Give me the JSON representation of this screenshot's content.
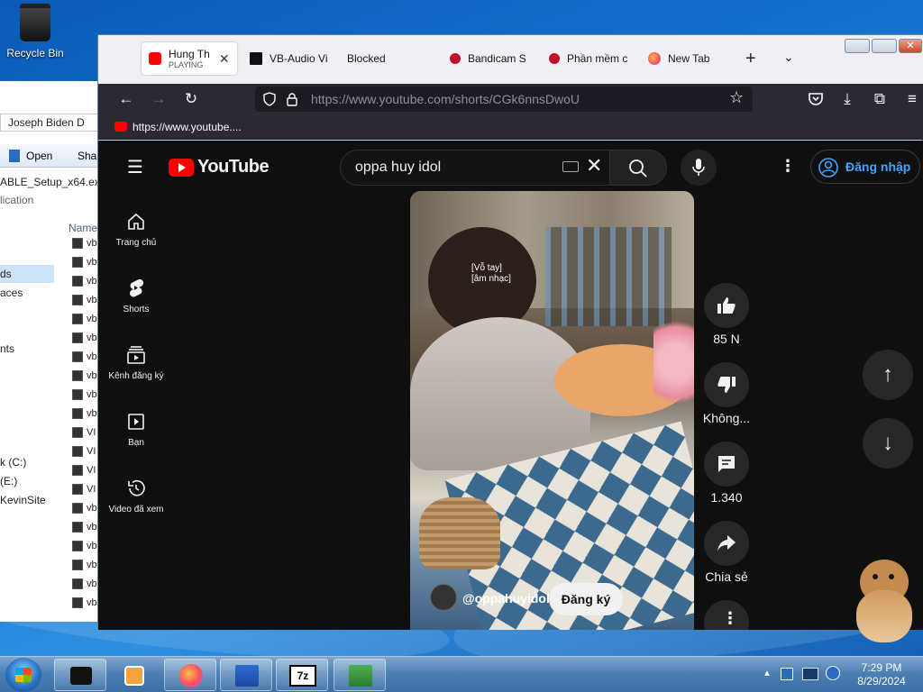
{
  "desktop": {
    "recycle_bin_label": "Recycle Bin"
  },
  "explorer": {
    "path_text": "Joseph Biden",
    "path_extra": "D",
    "open_label": "Open",
    "share_label": "Sha",
    "selected_file": "ABLE_Setup_x64.ex",
    "selected_type": "lication",
    "nav_items": [
      "ds",
      "aces",
      "nts",
      "k (C:)",
      "(E:)",
      "KevinSite"
    ],
    "column_header": "Name",
    "file_labels": [
      "vb",
      "vb",
      "vb",
      "vb",
      "vb",
      "vb",
      "vb",
      "vb",
      "vb",
      "vb",
      "VI",
      "VI",
      "VI",
      "VI",
      "vb",
      "vb",
      "vb",
      "vb",
      "vb",
      "vb"
    ]
  },
  "browser": {
    "tabs": [
      {
        "title": "Hung Th",
        "subtitle": "PLAYING",
        "icon": "youtube-icon",
        "active": true
      },
      {
        "title": "VB-Audio Vi",
        "icon": "vb-icon"
      },
      {
        "title": "Blocked",
        "icon": "none"
      },
      {
        "title": "Bandicam S",
        "icon": "bandicam-icon"
      },
      {
        "title": "Phần mềm c",
        "icon": "bandicam-icon"
      },
      {
        "title": "New Tab",
        "icon": "firefox-icon"
      }
    ],
    "url": "https://www.youtube.com/shorts/CGk6nnsDwoU",
    "bookmark_label": "https://www.youtube...."
  },
  "youtube": {
    "logo_text": "YouTube",
    "search_value": "oppa huy idol",
    "sign_in_label": "Đăng nhập",
    "sidebar": [
      {
        "label": "Trang chủ",
        "icon": "home-icon"
      },
      {
        "label": "Shorts",
        "icon": "shorts-icon"
      },
      {
        "label": "Kênh đăng ký",
        "icon": "subscriptions-icon"
      },
      {
        "label": "Bạn",
        "icon": "you-icon"
      },
      {
        "label": "Video đã xem",
        "icon": "history-icon"
      }
    ],
    "caption_line1": "[Vỗ tay]",
    "caption_line2": "[âm nhạc]",
    "channel_handle": "@oppahuyidol",
    "subscribe_label": "Đăng ký",
    "actions": {
      "like_count": "85 N",
      "dislike_label": "Không...",
      "comment_count": "1.340",
      "share_label": "Chia sẻ"
    }
  },
  "taskbar": {
    "time": "7:29 PM",
    "date": "8/29/2024",
    "pinned": [
      "bandicam-app",
      "media-player",
      "firefox",
      "installer",
      "7zip",
      "vb-audio"
    ]
  }
}
